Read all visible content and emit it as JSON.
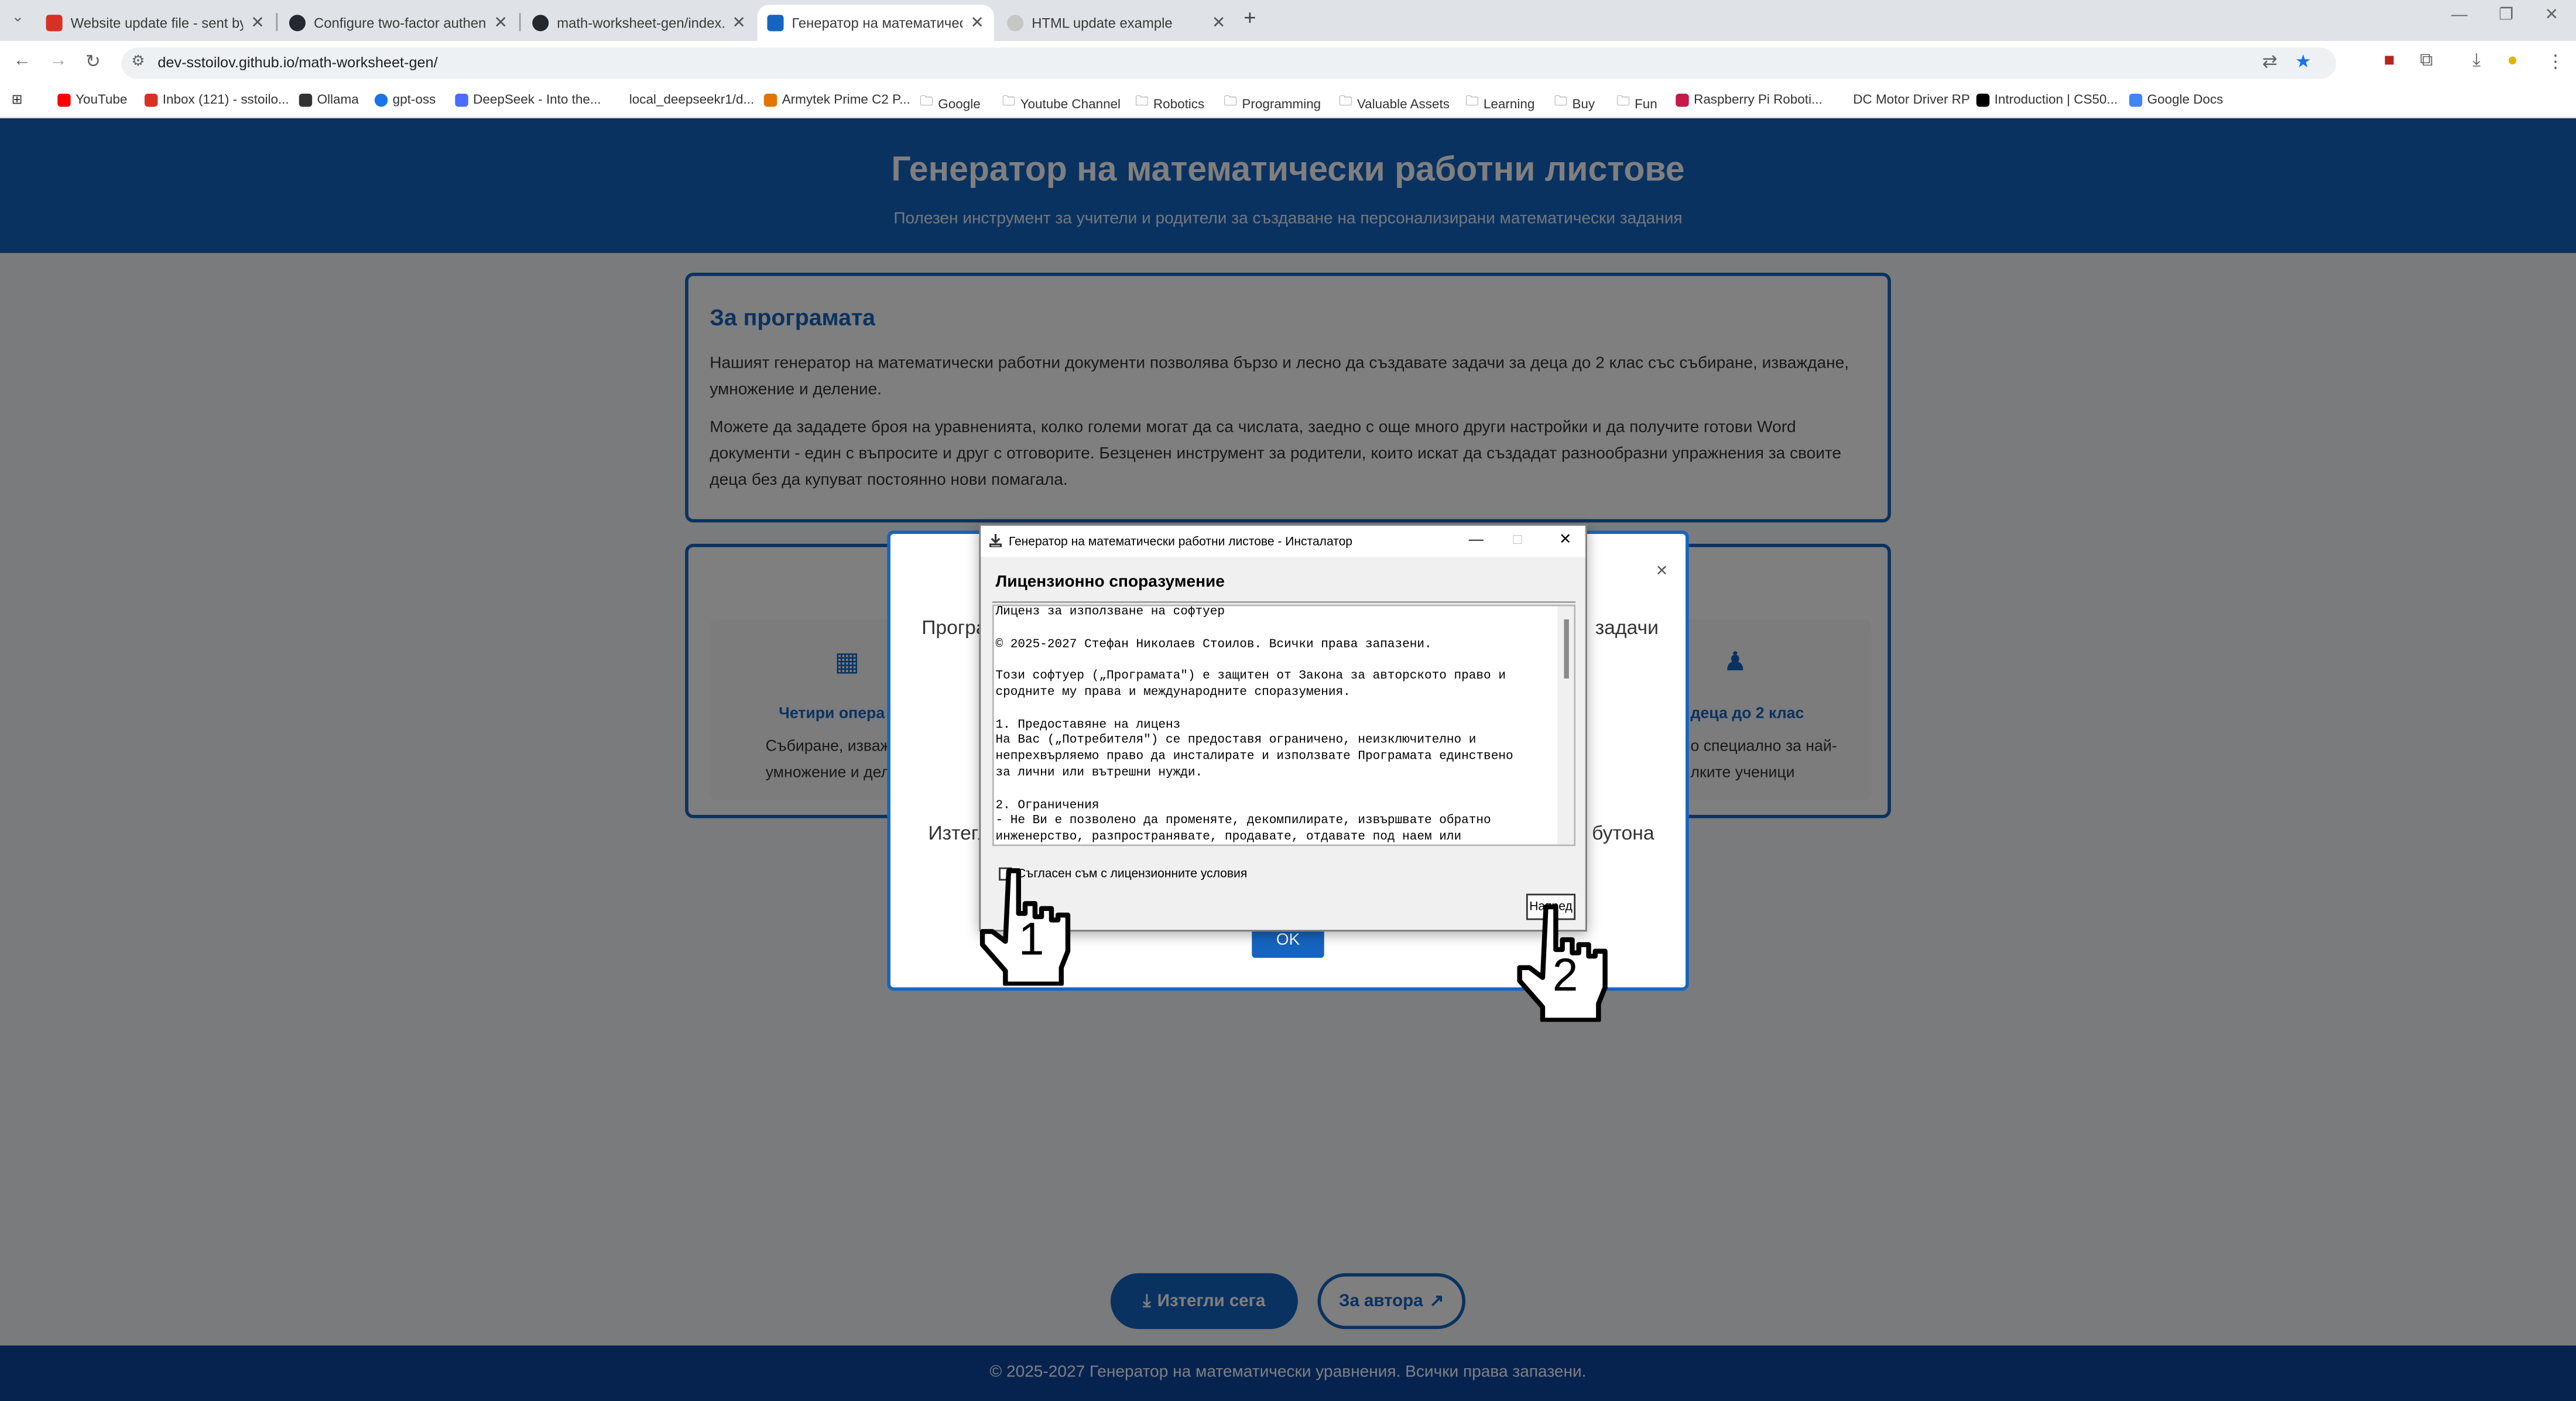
{
  "browser": {
    "tabs": [
      {
        "title": "Website update file - sent by s",
        "favicon_color": "#d93025"
      },
      {
        "title": "Configure two-factor authentic",
        "favicon_color": "#24292f"
      },
      {
        "title": "math-worksheet-gen/index.htm",
        "favicon_color": "#24292f"
      },
      {
        "title": "Генератор на математически",
        "favicon_color": "#1565c0"
      },
      {
        "title": "HTML update example",
        "favicon_color": "#9aa0a6"
      }
    ],
    "new_tab": "+",
    "url": "dev-sstoilov.github.io/math-worksheet-gen/",
    "bookmarks": [
      {
        "label": "YouTube",
        "color": "#ff0000"
      },
      {
        "label": "Inbox (121) - sstoilo...",
        "color": "#d93025"
      },
      {
        "label": "Ollama",
        "color": "#333333"
      },
      {
        "label": "gpt-oss",
        "color": "#1a73e8"
      },
      {
        "label": "DeepSeek - Into the...",
        "color": "#4d6bfe"
      },
      {
        "label": "local_deepseekr1/d...",
        "color": "#ffffff"
      },
      {
        "label": "Armytek Prime C2 P...",
        "color": "#e37400"
      },
      {
        "label": "Google",
        "color": "#5f6368"
      },
      {
        "label": "Youtube Channel",
        "color": "#5f6368"
      },
      {
        "label": "Robotics",
        "color": "#5f6368"
      },
      {
        "label": "Programming",
        "color": "#5f6368"
      },
      {
        "label": "Valuable Assets",
        "color": "#5f6368"
      },
      {
        "label": "Learning",
        "color": "#5f6368"
      },
      {
        "label": "Buy",
        "color": "#5f6368"
      },
      {
        "label": "Fun",
        "color": "#5f6368"
      },
      {
        "label": "Raspberry Pi Roboti...",
        "color": "#c51a4a"
      },
      {
        "label": "DC Motor Driver RP",
        "color": "#ffffff"
      },
      {
        "label": "Introduction | CS50...",
        "color": "#000000"
      },
      {
        "label": "Google Docs",
        "color": "#4285f4"
      }
    ]
  },
  "page": {
    "title": "Генератор на математически работни листове",
    "subtitle": "Полезен инструмент за учители и родители за създаване на персонализирани математически задания",
    "about": {
      "heading": "За програмата",
      "p1": "Нашият генератор на математически работни документи позволява бързо и лесно да създавате задачи за деца до 2 клас със събиране, изваждане, умножение и деление.",
      "p2": "Можете да зададете броя на уравненията, колко големи могат да са числата, заедно с още много други настройки и да получите готови Word документи - един с въпросите и друг с отговорите. Безценен инструмент за родители, които искат да създадат разнообразни упражнения за своите деца без да купуват постоянно нови помагала."
    },
    "features": {
      "left_title": "Четири опера",
      "left_line1": "Събиране, изваж",
      "left_line2": "умножение и дел",
      "right_title": "деца до 2 клас",
      "right_line1": "о специално за най-",
      "right_line2": "лките ученици"
    },
    "download_button": "Изтегли сега",
    "author_button": "За автора",
    "footer": "© 2025-2027 Генератор на математически уравнения. Всички права запазени."
  },
  "modal": {
    "text_left_top": "Програ",
    "text_right_top": "задачи",
    "text_left_bottom": "Изтегл",
    "text_right_bottom": "бутона",
    "ok_label": "OK",
    "close_glyph": "×"
  },
  "installer": {
    "window_title": "Генератор на математически работни листове - Инсталатор",
    "heading": "Лицензионно споразумение",
    "license_lines": [
      "Лиценз за използване на софтуер",
      "",
      "© 2025-2027 Стефан Николаев Стоилов. Всички права запазени.",
      "",
      "Този софтуер („Програмата\") е защитен от Закона за авторското право и",
      "сродните му права и международните споразумения.",
      "",
      "1. Предоставяне на лиценз",
      "На Вас („Потребителя\") се предоставя ограничено, неизключително и",
      "непрехвърляемо право да инсталирате и използвате Програмата единствено",
      "за лични или вътрешни нужди.",
      "",
      "2. Ограничения",
      "- Не Ви е позволено да променяте, декомпилирате, извършвате обратно",
      "инженерство, разпространявате, продавате, отдавате под наем или"
    ],
    "agree_label": "Съгласен съм с лицензионните условия",
    "next_button": "Напред"
  },
  "annotations": {
    "step1": "1",
    "step2": "2"
  }
}
